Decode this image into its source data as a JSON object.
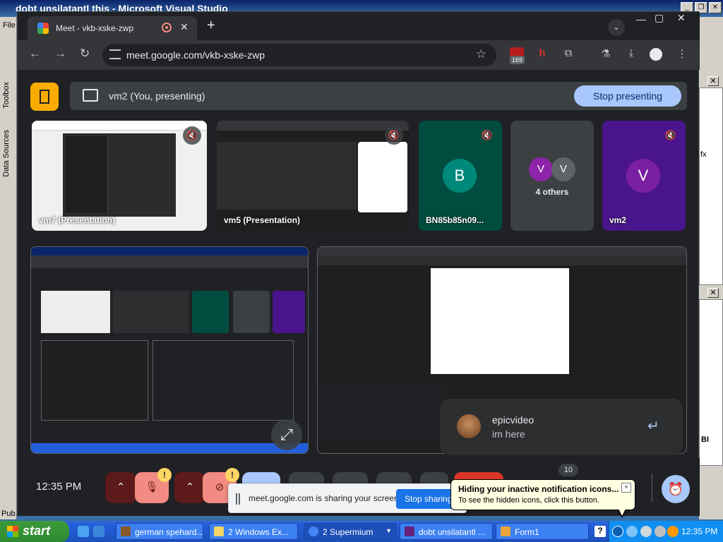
{
  "vs": {
    "title": "dobt unsilatantl this - Microsoft Visual Studio",
    "menu_file": "File",
    "toolbox": "Toolbox",
    "data_sources": "Data Sources",
    "pub": "Pub.",
    "right_fx": "fx",
    "right_bi": "BI"
  },
  "browser": {
    "tab_title": "Meet - vkb-xske-zwp",
    "url": "meet.google.com/vkb-xske-zwp",
    "ext_badge": "169"
  },
  "meet": {
    "presenting_label": "vm2 (You, presenting)",
    "stop_presenting": "Stop presenting",
    "tiles": [
      {
        "name": "vm7 (Presentation)"
      },
      {
        "name": "vm5 (Presentation)"
      },
      {
        "name": "BN85b85n09...",
        "initial": "B",
        "color": "#00796b"
      },
      {
        "name": "4 others",
        "initials": [
          "V",
          "V"
        ]
      },
      {
        "name": "vm2",
        "initial": "V",
        "color": "#7b1fa2"
      }
    ],
    "chat": {
      "sender": "epicvideo",
      "message": "im here"
    },
    "clock": "12:35 PM",
    "participants_count": "10",
    "warn": "!"
  },
  "sharebar": {
    "text": "meet.google.com is sharing your screen.",
    "stop_btn": "Stop sharing"
  },
  "balloon": {
    "title": "Hiding your inactive notification icons...",
    "body": "To see the hidden icons, click this button.",
    "close": "×"
  },
  "taskbar": {
    "start": "start",
    "tasks": [
      {
        "label": "german spehard..."
      },
      {
        "label": "2 Windows Ex..."
      },
      {
        "label": "2 Supermium"
      },
      {
        "label": "dobt unsilatantl ..."
      },
      {
        "label": "Form1"
      }
    ],
    "time": "12:35 PM"
  }
}
